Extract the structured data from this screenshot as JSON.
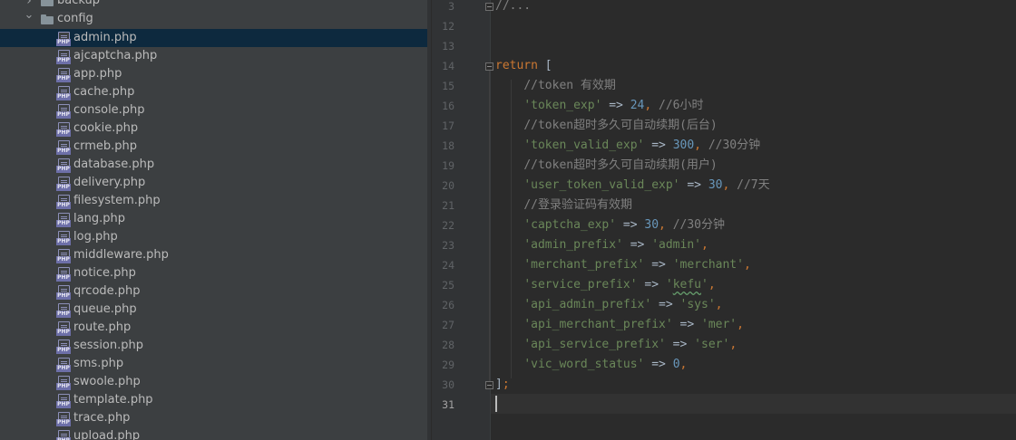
{
  "colors": {
    "sidebar_bg": "#3c3f41",
    "editor_bg": "#2b2b2b",
    "selection": "#0d293e",
    "keyword": "#cc7832",
    "string": "#6a8759",
    "number": "#6897bb",
    "comment": "#808080"
  },
  "tree": {
    "folders": [
      {
        "label": "backup",
        "expanded": false,
        "icon": "folder-icon"
      },
      {
        "label": "config",
        "expanded": true,
        "icon": "folder-icon"
      }
    ],
    "files": [
      "admin.php",
      "ajcaptcha.php",
      "app.php",
      "cache.php",
      "console.php",
      "cookie.php",
      "crmeb.php",
      "database.php",
      "delivery.php",
      "filesystem.php",
      "lang.php",
      "log.php",
      "middleware.php",
      "notice.php",
      "qrcode.php",
      "queue.php",
      "route.php",
      "session.php",
      "sms.php",
      "swoole.php",
      "template.php",
      "trace.php",
      "upload.php"
    ],
    "selected_file": "admin.php",
    "file_icon_tag": "PHP"
  },
  "editor": {
    "current_line": "31",
    "lines": [
      {
        "no": "3",
        "tokens": [
          {
            "t": "comment",
            "v": "//..."
          }
        ]
      },
      {
        "no": "12",
        "tokens": []
      },
      {
        "no": "13",
        "tokens": []
      },
      {
        "no": "14",
        "tokens": [
          {
            "t": "keyword",
            "v": "return"
          },
          {
            "t": "op",
            "v": " ["
          }
        ]
      },
      {
        "no": "15",
        "tokens": [
          {
            "t": "op",
            "v": "    "
          },
          {
            "t": "comment",
            "v": "//token 有效期"
          }
        ]
      },
      {
        "no": "16",
        "tokens": [
          {
            "t": "op",
            "v": "    "
          },
          {
            "t": "string",
            "v": "'token_exp'"
          },
          {
            "t": "op",
            "v": " => "
          },
          {
            "t": "number",
            "v": "24"
          },
          {
            "t": "keyword",
            "v": ","
          },
          {
            "t": "op",
            "v": " "
          },
          {
            "t": "comment",
            "v": "//6小时"
          }
        ]
      },
      {
        "no": "17",
        "tokens": [
          {
            "t": "op",
            "v": "    "
          },
          {
            "t": "comment",
            "v": "//token超时多久可自动续期(后台)"
          }
        ]
      },
      {
        "no": "18",
        "tokens": [
          {
            "t": "op",
            "v": "    "
          },
          {
            "t": "string",
            "v": "'token_valid_exp'"
          },
          {
            "t": "op",
            "v": " => "
          },
          {
            "t": "number",
            "v": "300"
          },
          {
            "t": "keyword",
            "v": ","
          },
          {
            "t": "op",
            "v": " "
          },
          {
            "t": "comment",
            "v": "//30分钟"
          }
        ]
      },
      {
        "no": "19",
        "tokens": [
          {
            "t": "op",
            "v": "    "
          },
          {
            "t": "comment",
            "v": "//token超时多久可自动续期(用户)"
          }
        ]
      },
      {
        "no": "20",
        "tokens": [
          {
            "t": "op",
            "v": "    "
          },
          {
            "t": "string",
            "v": "'user_token_valid_exp'"
          },
          {
            "t": "op",
            "v": " => "
          },
          {
            "t": "number",
            "v": "30"
          },
          {
            "t": "keyword",
            "v": ","
          },
          {
            "t": "op",
            "v": " "
          },
          {
            "t": "comment",
            "v": "//7天"
          }
        ]
      },
      {
        "no": "21",
        "tokens": [
          {
            "t": "op",
            "v": "    "
          },
          {
            "t": "comment",
            "v": "//登录验证码有效期"
          }
        ]
      },
      {
        "no": "22",
        "tokens": [
          {
            "t": "op",
            "v": "    "
          },
          {
            "t": "string",
            "v": "'captcha_exp'"
          },
          {
            "t": "op",
            "v": " => "
          },
          {
            "t": "number",
            "v": "30"
          },
          {
            "t": "keyword",
            "v": ","
          },
          {
            "t": "op",
            "v": " "
          },
          {
            "t": "comment",
            "v": "//30分钟"
          }
        ]
      },
      {
        "no": "23",
        "tokens": [
          {
            "t": "op",
            "v": "    "
          },
          {
            "t": "string",
            "v": "'admin_prefix'"
          },
          {
            "t": "op",
            "v": " => "
          },
          {
            "t": "string",
            "v": "'admin'"
          },
          {
            "t": "keyword",
            "v": ","
          }
        ]
      },
      {
        "no": "24",
        "tokens": [
          {
            "t": "op",
            "v": "    "
          },
          {
            "t": "string",
            "v": "'merchant_prefix'"
          },
          {
            "t": "op",
            "v": " => "
          },
          {
            "t": "string",
            "v": "'merchant'"
          },
          {
            "t": "keyword",
            "v": ","
          }
        ]
      },
      {
        "no": "25",
        "tokens": [
          {
            "t": "op",
            "v": "    "
          },
          {
            "t": "string",
            "v": "'service_prefix'"
          },
          {
            "t": "op",
            "v": " => "
          },
          {
            "t": "string",
            "v": "'"
          },
          {
            "t": "typo",
            "v": "kefu"
          },
          {
            "t": "string",
            "v": "'"
          },
          {
            "t": "keyword",
            "v": ","
          }
        ]
      },
      {
        "no": "26",
        "tokens": [
          {
            "t": "op",
            "v": "    "
          },
          {
            "t": "string",
            "v": "'api_admin_prefix'"
          },
          {
            "t": "op",
            "v": " => "
          },
          {
            "t": "string",
            "v": "'sys'"
          },
          {
            "t": "keyword",
            "v": ","
          }
        ]
      },
      {
        "no": "27",
        "tokens": [
          {
            "t": "op",
            "v": "    "
          },
          {
            "t": "string",
            "v": "'api_merchant_prefix'"
          },
          {
            "t": "op",
            "v": " => "
          },
          {
            "t": "string",
            "v": "'mer'"
          },
          {
            "t": "keyword",
            "v": ","
          }
        ]
      },
      {
        "no": "28",
        "tokens": [
          {
            "t": "op",
            "v": "    "
          },
          {
            "t": "string",
            "v": "'api_service_prefix'"
          },
          {
            "t": "op",
            "v": " => "
          },
          {
            "t": "string",
            "v": "'ser'"
          },
          {
            "t": "keyword",
            "v": ","
          }
        ]
      },
      {
        "no": "29",
        "tokens": [
          {
            "t": "op",
            "v": "    "
          },
          {
            "t": "string",
            "v": "'vic_word_status'"
          },
          {
            "t": "op",
            "v": " => "
          },
          {
            "t": "number",
            "v": "0"
          },
          {
            "t": "keyword",
            "v": ","
          }
        ]
      },
      {
        "no": "30",
        "tokens": [
          {
            "t": "op",
            "v": "]"
          },
          {
            "t": "keyword",
            "v": ";"
          }
        ]
      },
      {
        "no": "31",
        "tokens": []
      }
    ]
  }
}
